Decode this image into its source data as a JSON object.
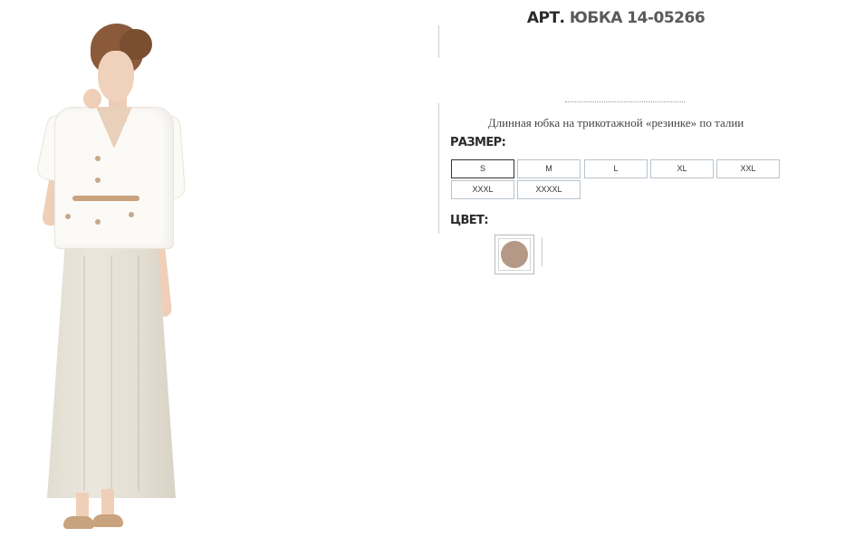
{
  "product": {
    "article_prefix": "АРТ.",
    "article_code": "ЮБКА 14-05266",
    "description": "Длинная юбка на трикотажной «резинке» по талии"
  },
  "size_section": {
    "label": "РАЗМЕР:",
    "selected": "S",
    "options": [
      "S",
      "M",
      "L",
      "XL",
      "XXL",
      "XXXL",
      "XXXXL"
    ]
  },
  "color_section": {
    "label": "ЦВЕТ:",
    "swatches": [
      {
        "color": "#b49a86",
        "selected": true
      }
    ]
  },
  "colors": {
    "text": "#333333",
    "border": "#b9c3cc",
    "selected_border": "#333333"
  }
}
